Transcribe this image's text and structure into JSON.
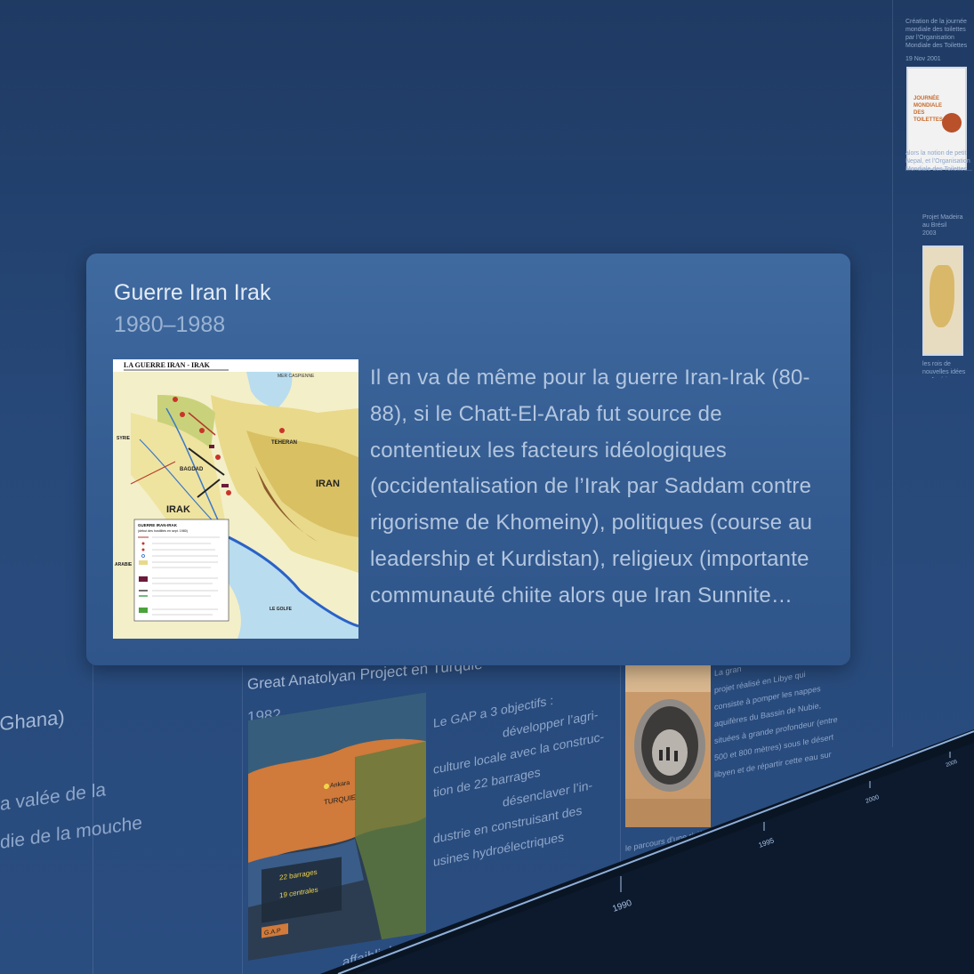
{
  "popover": {
    "title": "Guerre Iran Irak",
    "date": "1980–1988",
    "description": "Il en va de même pour la guerre Iran-Irak (80-88), si le Chatt-El-Arab fut source de contentieux les facteurs idéologiques (occidentalisation de l’Irak par Saddam contre rigorisme de Khomeiny), politiques (course au leadership et Kurdistan), religieux (importante communauté chiite alors que Iran Sunnite…",
    "map": {
      "title": "LA GUERRE IRAN - IRAK",
      "labels": {
        "caspian": "MER CASPIENNE",
        "teheran": "TEHERAN",
        "iran": "IRAN",
        "irak": "IRAK",
        "bagdad": "BAGDAD",
        "syrie": "SYRIE",
        "arabie": "ARABIE",
        "golfe": "LE GOLFE"
      },
      "legend_title": "GUERRE IRAN-IRAK",
      "legend_subtitle": "(début des hostilités en sept. 1980)"
    }
  },
  "background": {
    "gap_card": {
      "title": "Great Anatolyan Project en Turquie",
      "date": "1982",
      "text_lines": [
        "Le GAP a 3 objectifs :",
        "développer l’agri-",
        "culture locale avec la construc-",
        "tion de 22 barrages",
        "désenclaver l’in-",
        "dustrie en construisant des",
        "usines hydroélectriques",
        "affaiblir le mouvement Kurde et le légitimer l…"
      ],
      "map_labels": {
        "country": "TURQUIE",
        "city": "Ankara",
        "dams": "22 barrages",
        "plants": "19 centrales",
        "gap": "G.A.P"
      }
    },
    "ghana_card": {
      "title": "(Ghana)",
      "lines": [
        "a valée de la",
        "die de la mouche"
      ]
    },
    "libya_card": {
      "top": "La gran",
      "lines": [
        "projet réalisé en Libye qui",
        "consiste à pomper les nappes",
        "aquifères du Bassin de Nubie,",
        "situées à grande profondeur (entre",
        "500 et 800 mètres) sous le désert",
        "libyen et de répartir cette eau sur",
        "le parcours d’une rivière artificielle constituée d’une canalis…"
      ]
    },
    "right_column": {
      "card1_title": "Création de la journée mondiale des toilettes par l’Organisation Mondiale des Toilettes",
      "card1_date": "19 Nov 2001",
      "card1_logo": "JOURNÉE MONDIALE DES TOILETTES",
      "card1_text": "alors la notion de petit Nepal, et l’Organisation Mondiale des Toilettes...",
      "card2_title": "Projet Madeira au Brésil",
      "card2_date": "2003",
      "card2_text": "les rois de nouvelles idées en Amérique..."
    },
    "timeline_ticks": [
      "1990",
      "1995",
      "2000",
      "2005"
    ]
  },
  "colors": {
    "background": "#27497a",
    "popover": "#3a6399",
    "title": "#e3ebf5",
    "body_text": "#b3c6df"
  }
}
